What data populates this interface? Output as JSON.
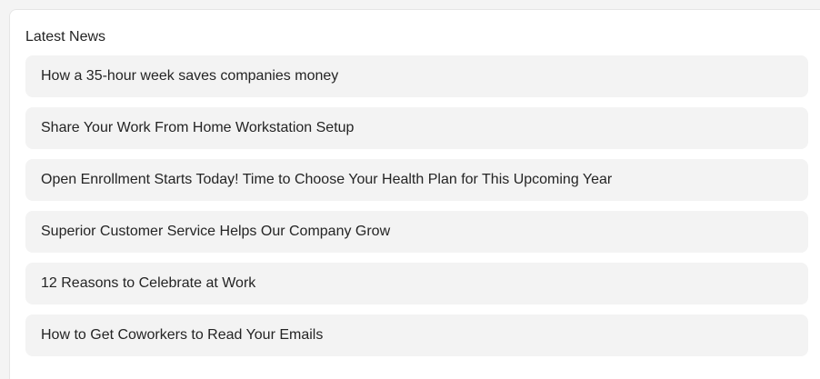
{
  "widget": {
    "title": "Latest News",
    "items": [
      {
        "label": "How a 35-hour week saves companies money"
      },
      {
        "label": "Share Your Work From Home Workstation Setup"
      },
      {
        "label": "Open Enrollment Starts Today! Time to Choose Your Health Plan for This Upcoming Year"
      },
      {
        "label": "Superior Customer Service Helps Our Company Grow"
      },
      {
        "label": "12 Reasons to Celebrate at Work"
      },
      {
        "label": "How to Get Coworkers to Read Your Emails"
      }
    ]
  }
}
